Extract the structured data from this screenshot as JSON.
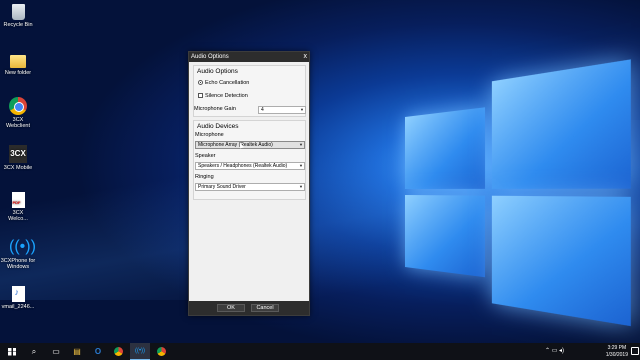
{
  "desktop": {
    "icons": [
      {
        "label": "Recycle Bin",
        "icon": "recycle-bin-icon"
      },
      {
        "label": "New folder",
        "icon": "folder-icon"
      },
      {
        "label": "3CX Webclient",
        "icon": "chrome-icon"
      },
      {
        "label": "3CX Mobile",
        "icon": "3cx-icon",
        "glyph": "3CX"
      },
      {
        "label": "3CX Welco...",
        "icon": "pdf-icon"
      },
      {
        "label": "3CXPhone for Windows",
        "icon": "wifi-phone-icon",
        "glyph": "((•))"
      },
      {
        "label": "vmail_2246...",
        "icon": "audio-file-icon"
      }
    ]
  },
  "dialog": {
    "title": "Audio Options",
    "close_glyph": "x",
    "audio_options": {
      "title": "Audio Options",
      "echo_cancellation": "Echo Cancellation",
      "silence_detection": "Silence Detection",
      "microphone_gain_label": "Microphone Gain",
      "microphone_gain_value": "4"
    },
    "audio_devices": {
      "title": "Audio Devices",
      "microphone_label": "Microphone",
      "microphone_value": "Microphone Array (Realtek Audio)",
      "speaker_label": "Speaker",
      "speaker_value": "Speakers / Headphones (Realtek Audio)",
      "ringing_label": "Ringing",
      "ringing_value": "Primary Sound Driver"
    },
    "ok_label": "OK",
    "cancel_label": "Cancel",
    "dropdown_arrow": "▼"
  },
  "taskbar": {
    "search_glyph": "⌕",
    "taskview_glyph": "▭",
    "file_glyph": "▤",
    "outlook_glyph": "O",
    "wifi_glyph": "((•))",
    "time": "3:29 PM",
    "date": "1/30/2019",
    "tray_glyphs": "⌃  ▭  ◂)"
  }
}
